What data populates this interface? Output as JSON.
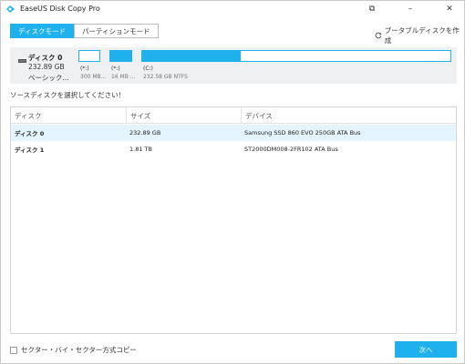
{
  "titlebar": {
    "title": "EaseUS Disk Copy Pro",
    "restore_icon": "⧉",
    "minimize_icon": "–",
    "close_icon": "✕"
  },
  "mode_tabs": [
    {
      "label": "ディスクモード",
      "active": true
    },
    {
      "label": "パーティションモード",
      "active": false
    }
  ],
  "portable_label": "ブータブルディスクを作成",
  "disk": {
    "name": "ディスク 0",
    "size": "232.89 GB",
    "type": "ベーシック...",
    "partitions": [
      {
        "label": "(*:)",
        "info": "300 MB...",
        "used_fraction": 0.0
      },
      {
        "label": "(*:)",
        "info": "16 MB ...",
        "used_fraction": 1.0
      },
      {
        "label": "(C:)",
        "info": "232.58 GB NTFS",
        "used_fraction": 0.32
      }
    ]
  },
  "prompt": "ソースディスクを選択してください！",
  "table": {
    "headers": [
      "ディスク",
      "サイズ",
      "デバイス"
    ],
    "rows": [
      {
        "disk": "ディスク 0",
        "size": "232.89 GB",
        "device": "Samsung SSD 860 EVO 250GB ATA Bus",
        "selected": true
      },
      {
        "disk": "ディスク 1",
        "size": "1.81 TB",
        "device": "ST2000DM008-2FR102 ATA Bus",
        "selected": false
      }
    ]
  },
  "sector_copy_label": "セクター・バイ・セクター方式コピー",
  "next_label": "次へ",
  "colors": {
    "accent": "#1fb0ee",
    "selected_row": "#e4f4fc",
    "panel": "#eef0f2"
  }
}
